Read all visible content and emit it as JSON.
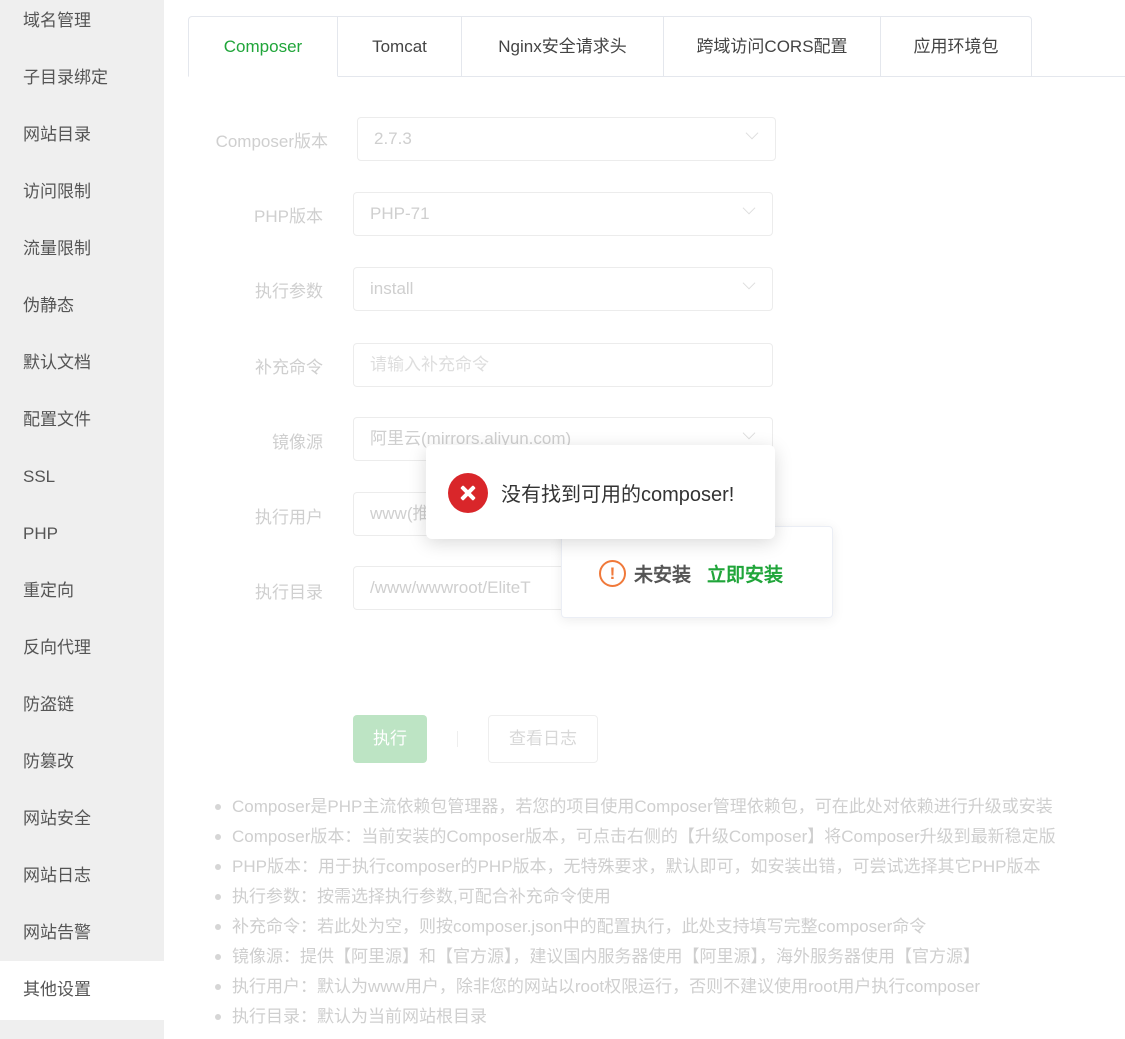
{
  "sidebar": {
    "items": [
      {
        "label": "域名管理"
      },
      {
        "label": "子目录绑定"
      },
      {
        "label": "网站目录"
      },
      {
        "label": "访问限制"
      },
      {
        "label": "流量限制"
      },
      {
        "label": "伪静态"
      },
      {
        "label": "默认文档"
      },
      {
        "label": "配置文件"
      },
      {
        "label": "SSL"
      },
      {
        "label": "PHP"
      },
      {
        "label": "重定向"
      },
      {
        "label": "反向代理"
      },
      {
        "label": "防盗链"
      },
      {
        "label": "防篡改"
      },
      {
        "label": "网站安全"
      },
      {
        "label": "网站日志"
      },
      {
        "label": "网站告警"
      },
      {
        "label": "其他设置",
        "active": true
      }
    ]
  },
  "tabs": [
    {
      "label": "Composer",
      "active": true
    },
    {
      "label": "Tomcat"
    },
    {
      "label": "Nginx安全请求头"
    },
    {
      "label": "跨域访问CORS配置"
    },
    {
      "label": "应用环境包"
    }
  ],
  "form": {
    "composer_version": {
      "label": "Composer版本",
      "value": "2.7.3"
    },
    "php_version": {
      "label": "PHP版本",
      "value": "PHP-71"
    },
    "exec_param": {
      "label": "执行参数",
      "value": "install"
    },
    "extra_cmd": {
      "label": "补充命令",
      "value": "",
      "placeholder": "请输入补充命令"
    },
    "mirror": {
      "label": "镜像源",
      "value": "阿里云(mirrors.aliyun.com)"
    },
    "exec_user": {
      "label": "执行用户",
      "value": "www(推荐)"
    },
    "exec_dir": {
      "label": "执行目录",
      "value": "/www/wwwroot/EliteT"
    }
  },
  "buttons": {
    "execute": "执行",
    "view_log": "查看日志"
  },
  "help": [
    "Composer是PHP主流依赖包管理器，若您的项目使用Composer管理依赖包，可在此处对依赖进行升级或安装",
    "Composer版本：当前安装的Composer版本，可点击右侧的【升级Composer】将Composer升级到最新稳定版",
    "PHP版本：用于执行composer的PHP版本，无特殊要求，默认即可，如安装出错，可尝试选择其它PHP版本",
    "执行参数：按需选择执行参数,可配合补充命令使用",
    "补充命令：若此处为空，则按composer.json中的配置执行，此处支持填写完整composer命令",
    "镜像源：提供【阿里源】和【官方源】，建议国内服务器使用【阿里源】，海外服务器使用【官方源】",
    "执行用户：默认为www用户，除非您的网站以root权限运行，否则不建议使用root用户执行composer",
    "执行目录：默认为当前网站根目录"
  ],
  "popover": {
    "icon": "warning-circle-icon",
    "status": "未安装",
    "action": "立即安装"
  },
  "toast": {
    "icon": "error-circle-icon",
    "message": "没有找到可用的composer!"
  },
  "colors": {
    "accent": "#20a53a",
    "error": "#d9262a",
    "warning": "#f0793a"
  }
}
